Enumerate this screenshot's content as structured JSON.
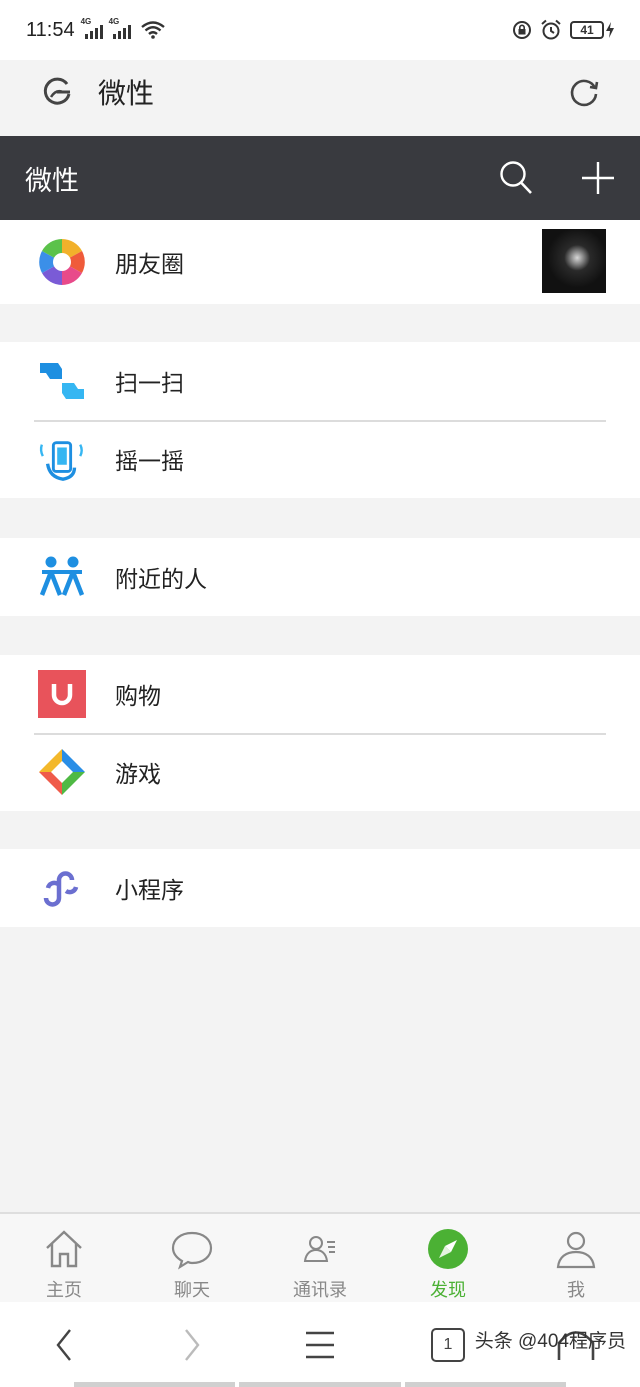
{
  "status_bar": {
    "time": "11:54",
    "network_1": "4G",
    "network_2": "4G",
    "battery": "41"
  },
  "browser": {
    "address": "微性"
  },
  "header": {
    "title": "微性"
  },
  "discover": {
    "moments": "朋友圈",
    "scan": "扫一扫",
    "shake": "摇一摇",
    "nearby": "附近的人",
    "shopping": "购物",
    "games": "游戏",
    "mini_programs": "小程序"
  },
  "tabs": [
    {
      "label": "主页",
      "icon": "home-icon"
    },
    {
      "label": "聊天",
      "icon": "chat-bubble-icon"
    },
    {
      "label": "通讯录",
      "icon": "contacts-icon"
    },
    {
      "label": "发现",
      "icon": "compass-icon",
      "active": true
    },
    {
      "label": "我",
      "icon": "person-icon"
    }
  ],
  "nav": {
    "tabs_count": "1"
  },
  "watermark": "头条 @404程序员",
  "colors": {
    "header_bg": "#393a3f",
    "active_green": "#4bb134",
    "shopping_red": "#e8535b"
  }
}
